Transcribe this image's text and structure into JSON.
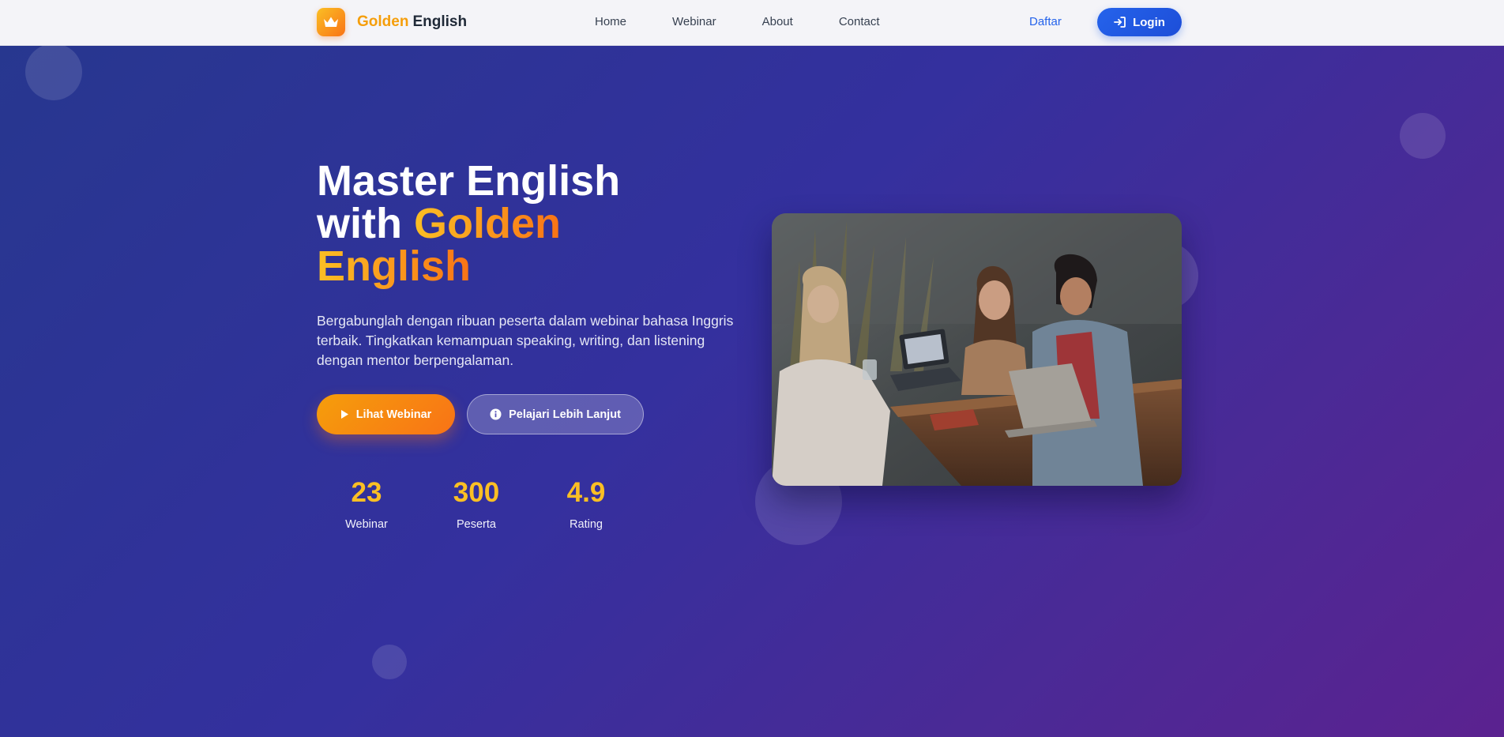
{
  "navbar": {
    "brand": {
      "logo_icon": "crown-icon",
      "word1": "Golden",
      "word2": "English"
    },
    "links": [
      "Home",
      "Webinar",
      "About",
      "Contact"
    ],
    "register_label": "Daftar",
    "login_label": "Login",
    "login_icon": "sign-in-icon"
  },
  "hero": {
    "title_line1": "Master English",
    "title_with": "with",
    "title_golden": "Golden",
    "title_english": "English",
    "description": "Bergabunglah dengan ribuan peserta dalam webinar bahasa Inggris terbaik. Tingkatkan kemampuan speaking, writing, dan listening dengan mentor berpengalaman.",
    "primary_button": {
      "label": "Lihat Webinar",
      "icon": "play-icon"
    },
    "secondary_button": {
      "label": "Pelajari Lebih Lanjut",
      "icon": "info-circle-icon"
    },
    "stats": [
      {
        "value": "23",
        "label": "Webinar"
      },
      {
        "value": "300",
        "label": "Peserta"
      },
      {
        "value": "4.9",
        "label": "Rating"
      }
    ],
    "image_icon": "students-photo"
  },
  "colors": {
    "accent_gold": "#fbbf24",
    "accent_orange": "#f97316",
    "brand_blue": "#2563eb",
    "hero_start": "#27378f",
    "hero_end": "#5b2290"
  }
}
